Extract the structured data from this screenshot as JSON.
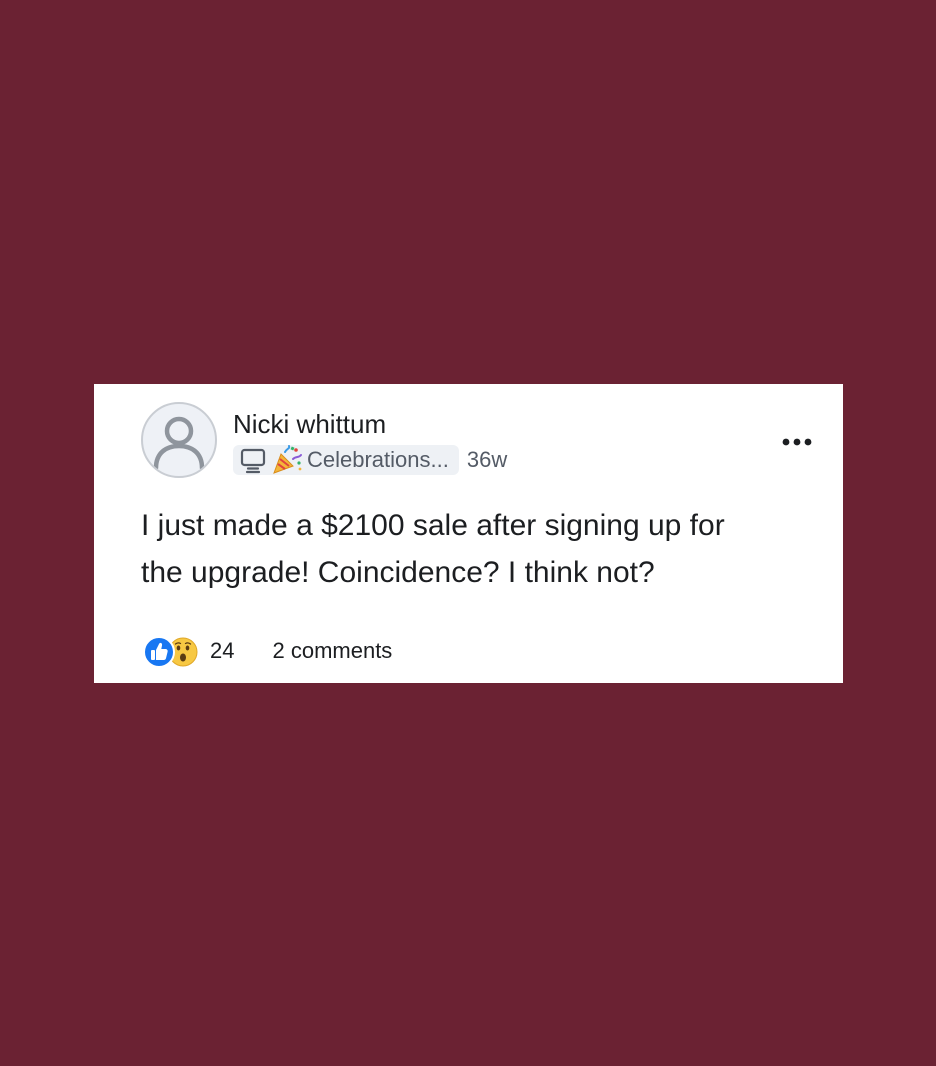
{
  "colors": {
    "background": "#6b2233",
    "card": "#ffffff",
    "text": "#1c1e21",
    "muted_text": "#545b66",
    "chip_bg": "#eef1f5",
    "like_blue": "#1877f2",
    "wow_yellow": "#f7c843"
  },
  "post": {
    "author": {
      "name": "Nicki whittum",
      "avatar_icon": "default-user-avatar-icon"
    },
    "space": {
      "icon": "computer-monitor-icon",
      "emoji_icon": "party-popper-icon",
      "name": "Celebrations..."
    },
    "age": "36w",
    "more_icon": "more-options-icon",
    "body_line_1": "I just made a $2100 sale after signing up for",
    "body_line_2": "the upgrade! Coincidence? I think not?",
    "reactions": {
      "icons": [
        "like-icon",
        "wow-emoji-icon"
      ],
      "count": "24"
    },
    "comments": "2 comments"
  }
}
